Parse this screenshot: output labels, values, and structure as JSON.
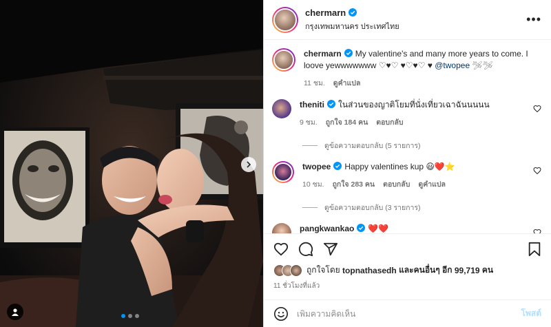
{
  "post": {
    "author": "chermarn",
    "location": "กรุงเทพมหานคร ประเทศไทย",
    "more_label": "•••",
    "carousel_index": 1,
    "carousel_count": 3
  },
  "caption": {
    "user": "chermarn",
    "text": "My valentine's and many more years to come. I loove yewwwwwww ♡♥♡ ♥♡♥♡ ♥",
    "mention": "@twopee",
    "trail": "🛩🛩",
    "time": "11 ชม.",
    "translate": "ดูคำแปล"
  },
  "comments": [
    {
      "user": "theniti",
      "text": "ในส่วนของญาติโยมที่นั่งเที่ยวเฉาฉันนนนน",
      "time": "9 ชม.",
      "likes": "ถูกใจ 184 คน",
      "reply": "ตอบกลับ",
      "view_replies": "ดูข้อความตอบกลับ (5 รายการ)",
      "verified": true
    },
    {
      "user": "twopee",
      "text": "Happy valentines kup 😃❤️⭐",
      "time": "10 ชม.",
      "likes": "ถูกใจ 283 คน",
      "reply": "ตอบกลับ",
      "translate": "ดูคำแปล",
      "view_replies": "ดูข้อความตอบกลับ (3 รายการ)",
      "verified": true
    },
    {
      "user": "pangkwankao",
      "text": "❤️❤️",
      "verified": true
    }
  ],
  "likes_summary": {
    "prefix": "ถูกใจโดย",
    "user": "topnathasedh",
    "middle": "และคนอื่นๆ อีก",
    "count": "99,719",
    "suffix": "คน"
  },
  "timestamp": "11 ชั่วโมงที่แล้ว",
  "composer": {
    "placeholder": "เพิ่มความคิดเห็น",
    "post_label": "โพสต์"
  },
  "colors": {
    "verified": "#0095f6",
    "heart_red": "#ed4956",
    "link": "#00376b"
  },
  "icons": [
    "heart-icon",
    "comment-icon",
    "share-icon",
    "bookmark-icon",
    "emoji-icon",
    "chevron-right-icon",
    "user-tag-icon",
    "more-icon"
  ]
}
